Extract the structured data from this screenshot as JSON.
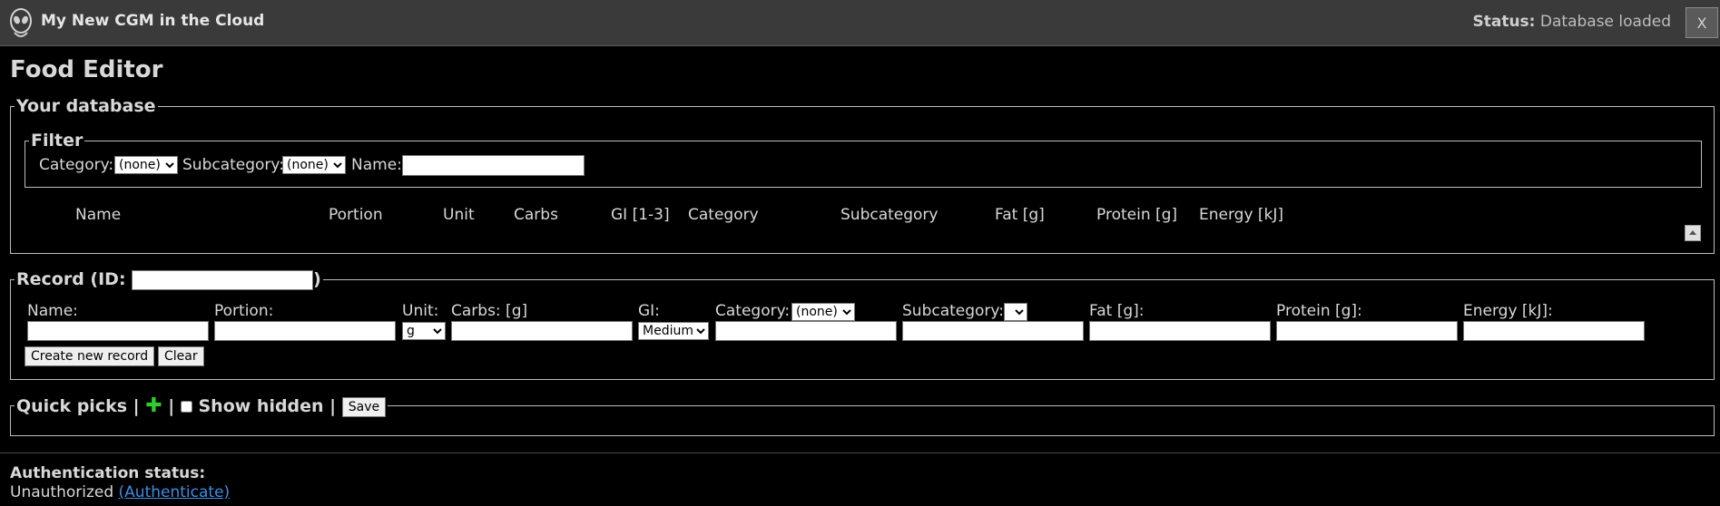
{
  "app": {
    "title": "My New CGM in the Cloud",
    "status_label": "Status:",
    "status_value": "Database loaded",
    "close_label": "X"
  },
  "page_title": "Food Editor",
  "database": {
    "legend": "Your database",
    "filter": {
      "legend": "Filter",
      "category_label": "Category:",
      "category_value": "(none)",
      "subcategory_label": "Subcategory:",
      "subcategory_value": "(none)",
      "name_label": "Name:",
      "name_value": ""
    },
    "columns": [
      "Name",
      "Portion",
      "Unit",
      "Carbs",
      "GI [1-3]",
      "Category",
      "Subcategory",
      "Fat [g]",
      "Protein [g]",
      "Energy [kJ]"
    ]
  },
  "record": {
    "legend_prefix": "Record (ID:",
    "legend_suffix": ")",
    "id_value": "",
    "labels": {
      "name": "Name:",
      "portion": "Portion:",
      "unit": "Unit:",
      "carbs": "Carbs: [g]",
      "gi": "GI:",
      "category": "Category:",
      "subcategory": "Subcategory:",
      "fat": "Fat [g]:",
      "protein": "Protein [g]:",
      "energy": "Energy [kJ]:"
    },
    "unit_value": "g",
    "gi_value": "Medium",
    "category_value": "(none)",
    "subcategory_value": "",
    "create_label": "Create new record",
    "clear_label": "Clear"
  },
  "quick_picks": {
    "title": "Quick picks |",
    "sep": "|",
    "show_hidden_label": "Show hidden |",
    "save_label": "Save",
    "add_icon": "plus-icon"
  },
  "auth": {
    "title": "Authentication status:",
    "status": "Unauthorized",
    "link": "(Authenticate)"
  },
  "colors": {
    "background": "#000000",
    "topbar": "#3a3a3a",
    "add_icon": "#2ecc2e",
    "link": "#3a8ee6"
  }
}
